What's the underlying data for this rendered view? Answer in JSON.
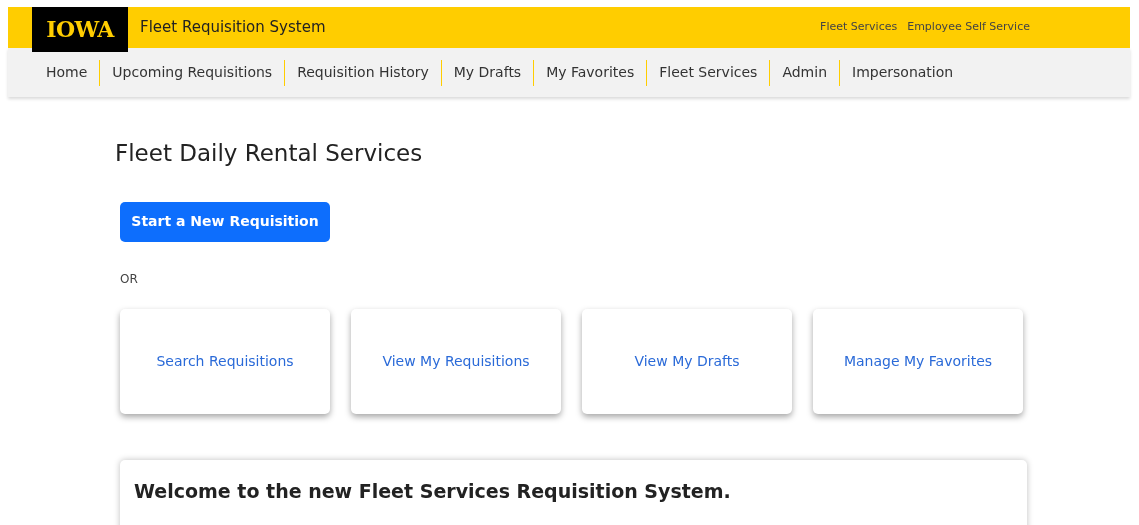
{
  "header": {
    "logo": "IOWA",
    "title": "Fleet Requisition System",
    "links": [
      "Fleet Services",
      "Employee Self Service"
    ]
  },
  "nav": [
    "Home",
    "Upcoming Requisitions",
    "Requisition History",
    "My Drafts",
    "My Favorites",
    "Fleet Services",
    "Admin",
    "Impersonation"
  ],
  "page": {
    "title": "Fleet Daily Rental Services",
    "primary_button": "Start a New Requisition",
    "separator": "OR",
    "cards": [
      "Search Requisitions",
      "View My Requisitions",
      "View My Drafts",
      "Manage My Favorites"
    ],
    "welcome_title": "Welcome to the new Fleet Services Requisition System."
  }
}
